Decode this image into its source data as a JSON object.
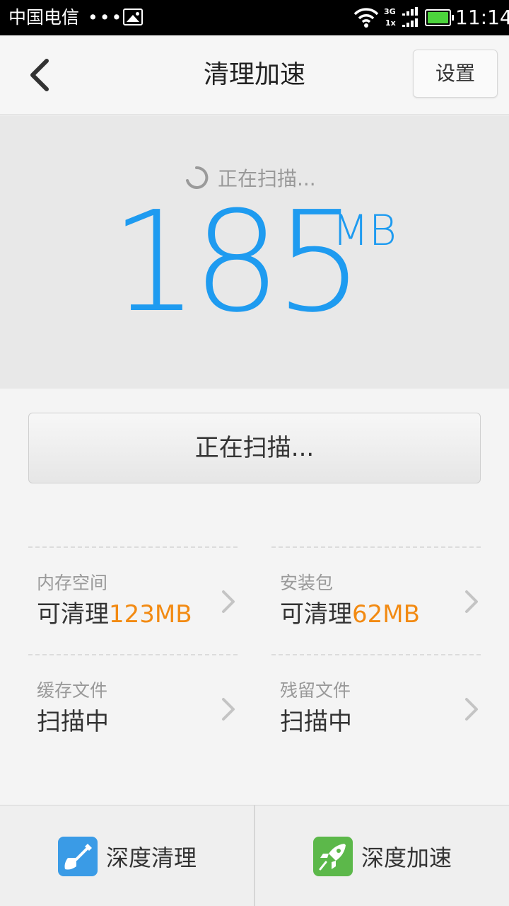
{
  "status_bar": {
    "carrier": "中国电信",
    "dots": "•••",
    "net_top": "3G",
    "net_bottom": "1x",
    "time": "11:14",
    "battery_color": "#4cd43c"
  },
  "header": {
    "title": "清理加速",
    "settings_label": "设置",
    "back_icon": "chevron-left-icon"
  },
  "hero": {
    "status_text": "正在扫描...",
    "size_value": "185",
    "size_unit": "MB",
    "accent_color": "#1e9bf0"
  },
  "scan_button": {
    "label": "正在扫描..."
  },
  "items": [
    {
      "label": "内存空间",
      "prefix": "可清理",
      "amount": "123MB"
    },
    {
      "label": "安装包",
      "prefix": "可清理",
      "amount": "62MB"
    },
    {
      "label": "缓存文件",
      "prefix": "扫描中",
      "amount": ""
    },
    {
      "label": "残留文件",
      "prefix": "扫描中",
      "amount": ""
    }
  ],
  "highlight_color": "#f28a12",
  "bottom_bar": {
    "deep_clean_label": "深度清理",
    "deep_clean_icon": "shovel-icon",
    "deep_clean_color": "#3a9be6",
    "deep_boost_label": "深度加速",
    "deep_boost_icon": "rocket-icon",
    "deep_boost_color": "#5cb84a"
  }
}
